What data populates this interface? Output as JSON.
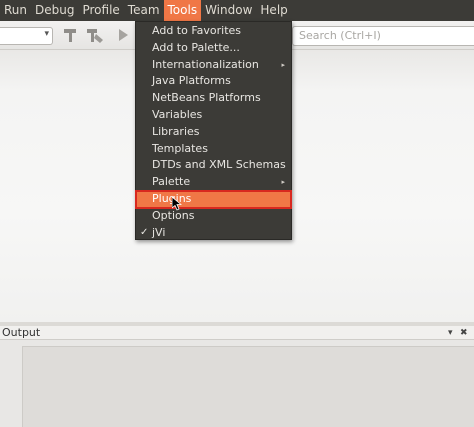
{
  "menubar": {
    "items": [
      "Run",
      "Debug",
      "Profile",
      "Team",
      "Tools",
      "Window",
      "Help"
    ],
    "active_index": 4
  },
  "toolbar": {
    "combo_arrow": "▾",
    "search_placeholder": "Search (Ctrl+I)"
  },
  "tools_menu": {
    "items": [
      {
        "label": "Add to Favorites"
      },
      {
        "label": "Add to Palette..."
      },
      {
        "label": "Internationalization",
        "submenu": true
      },
      {
        "label": "Java Platforms"
      },
      {
        "label": "NetBeans Platforms"
      },
      {
        "label": "Variables"
      },
      {
        "label": "Libraries"
      },
      {
        "label": "Templates"
      },
      {
        "label": "DTDs and XML Schemas"
      },
      {
        "label": "Palette",
        "submenu": true
      },
      {
        "label": "Plugins",
        "highlighted": true
      },
      {
        "label": "Options"
      },
      {
        "label": "jVi",
        "checked": true
      }
    ],
    "submenu_glyph": "▸",
    "check_glyph": "✓"
  },
  "output": {
    "title": "Output",
    "ctrl_dropdown": "▾",
    "ctrl_close": "✖"
  },
  "colors": {
    "menubar_bg": "#3c3b37",
    "accent": "#f07746",
    "highlight_border": "#d8281f"
  }
}
